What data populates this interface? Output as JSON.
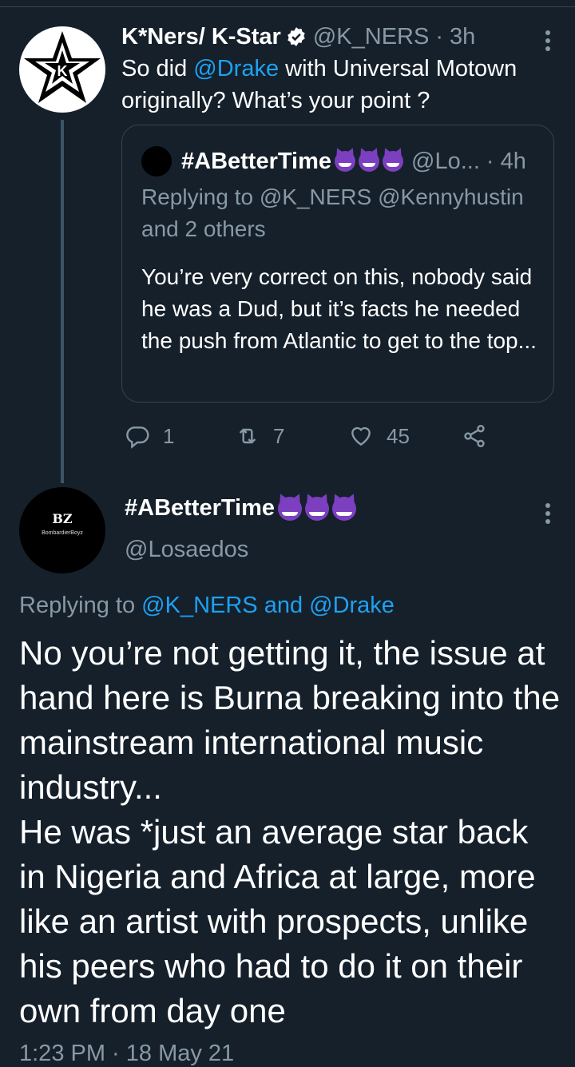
{
  "reply_tweet": {
    "author_name": "K*Ners/ K-Star",
    "handle": "@K_NERS",
    "time": "· 3h",
    "text_parts": [
      "So did ",
      "@Drake",
      " with Universal Motown originally? What’s your point ?"
    ],
    "quoted": {
      "author_name": "#ABetterTime",
      "handle": "@Lo...",
      "time": "· 4h",
      "replying_to": "Replying to @K_NERS @Kennyhustin and 2 others",
      "text": "You’re very correct on this, nobody said he was a Dud, but it’s facts he needed the push from Atlantic to get to the top..."
    },
    "actions": {
      "replies": "1",
      "retweets": "7",
      "likes": "45"
    }
  },
  "main_tweet": {
    "author_name": "#ABetterTime",
    "handle": "@Losaedos",
    "avatar_text": "BZ",
    "avatar_subtext": "BombardierBoyz",
    "replying_prefix": "Replying to ",
    "replying_user1": "@K_NERS",
    "replying_and": " and ",
    "replying_user2": "@Drake",
    "text": "No you’re not getting it, the issue at hand here is Burna breaking into the mainstream international music industry...\nHe was *just an average star back in Nigeria and Africa at large, more like an artist with prospects, unlike his peers who had to do it on their own from day one",
    "timestamp": "1:23 PM · 18 May 21"
  },
  "colors": {
    "background": "#15202b",
    "link": "#1da1f2",
    "muted": "#8899a6",
    "border": "#38444d"
  }
}
